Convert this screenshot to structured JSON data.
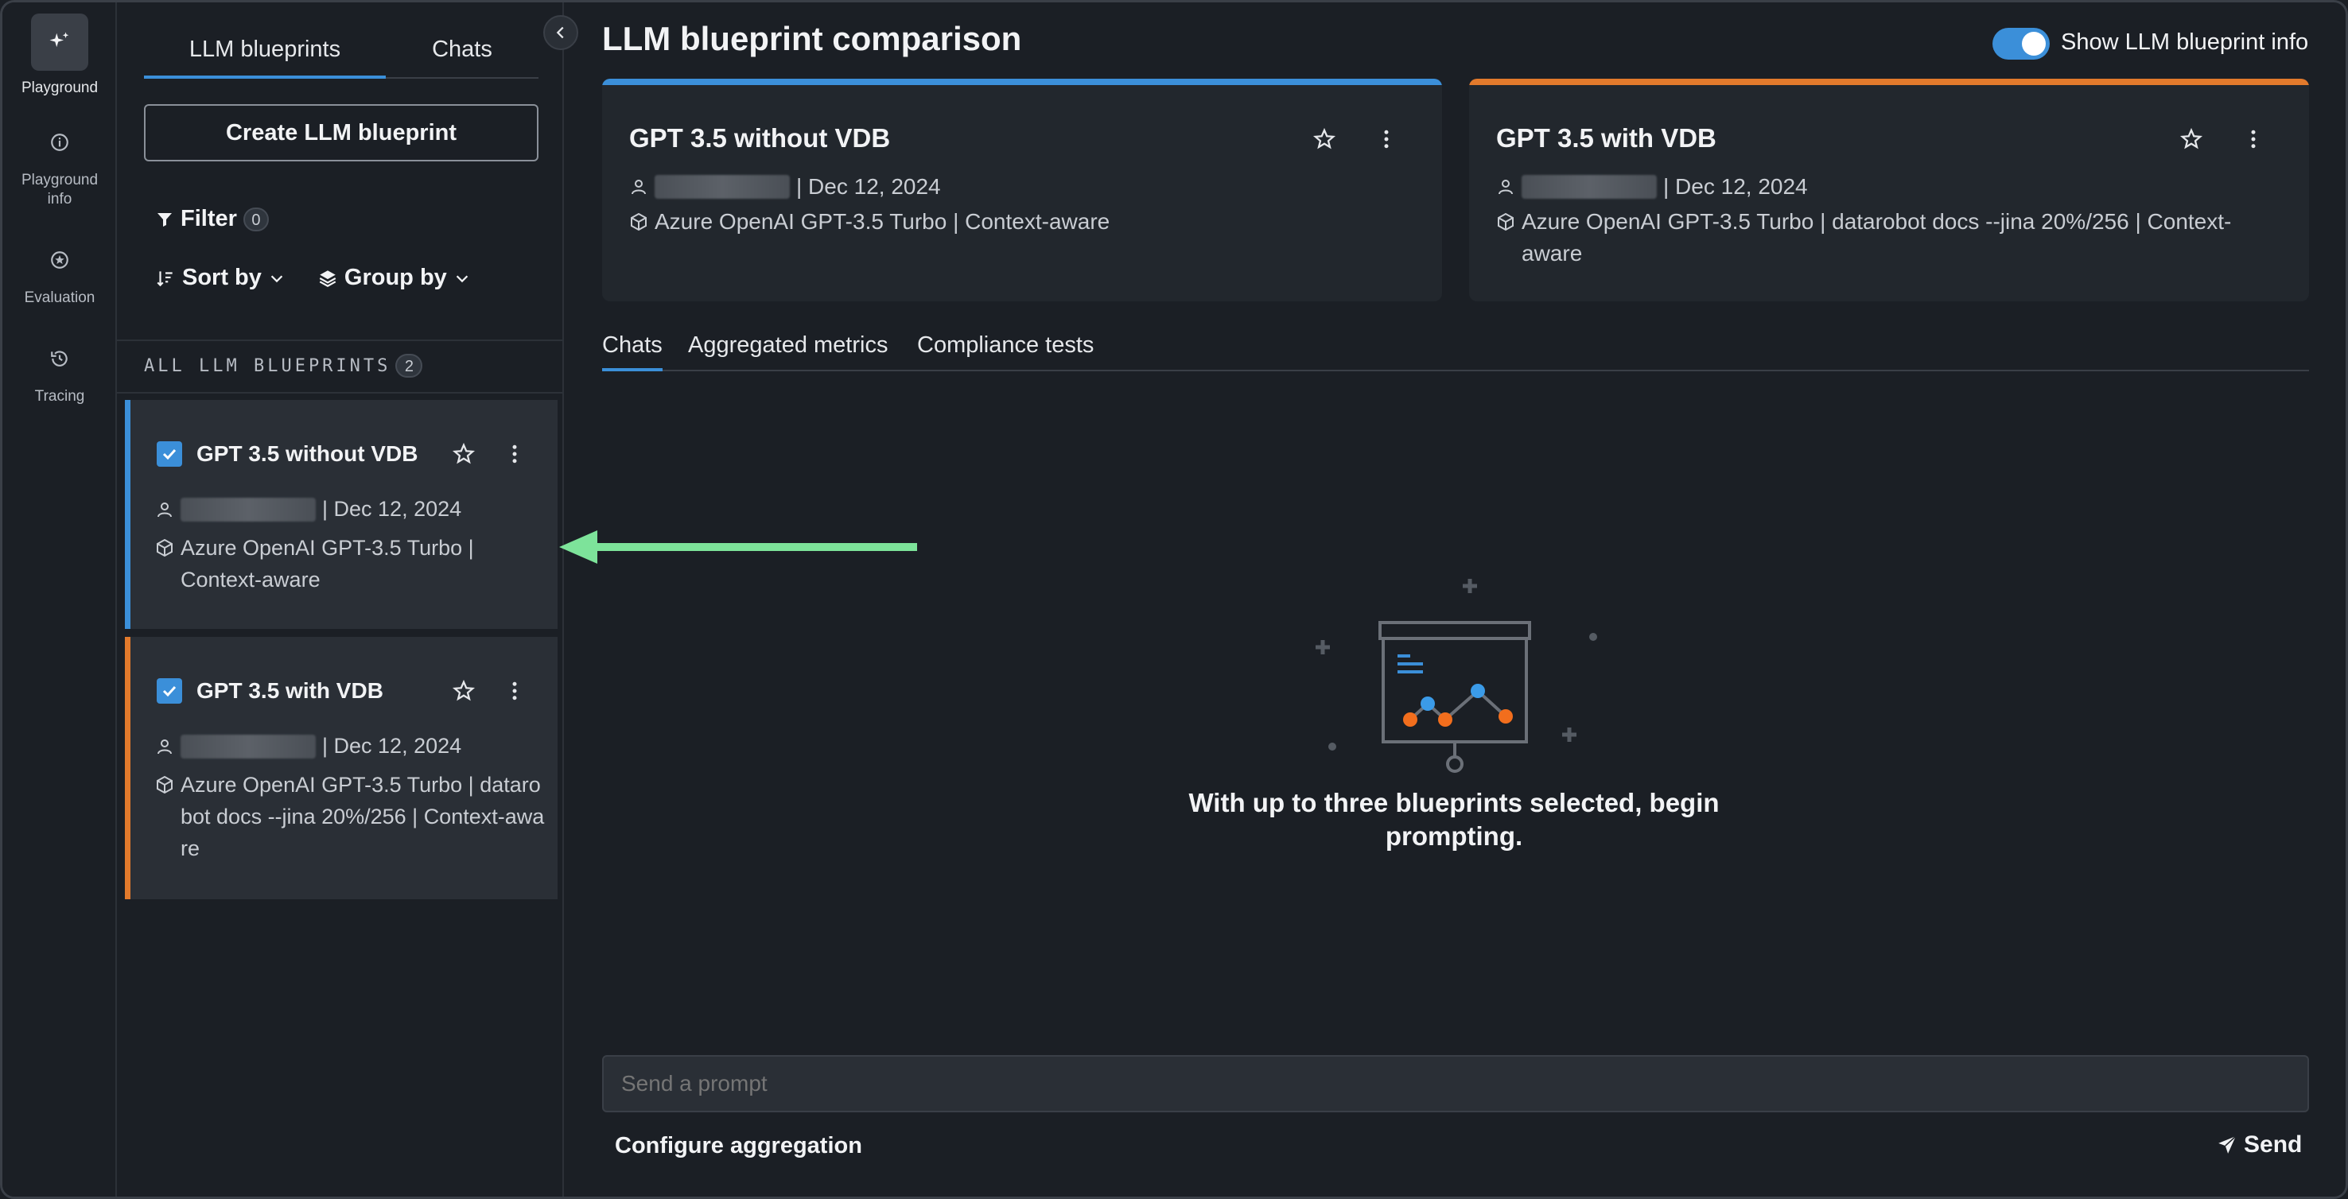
{
  "rail": {
    "items": [
      {
        "label": "Playground",
        "icon": "sparkle-icon",
        "active": true
      },
      {
        "label": "Playground info",
        "icon": "info-icon",
        "active": false
      },
      {
        "label": "Evaluation",
        "icon": "evaluation-icon",
        "active": false
      },
      {
        "label": "Tracing",
        "icon": "history-icon",
        "active": false
      }
    ]
  },
  "panel": {
    "tabs": [
      {
        "label": "LLM blueprints",
        "active": true
      },
      {
        "label": "Chats",
        "active": false
      }
    ],
    "create_label": "Create LLM blueprint",
    "filter_label": "Filter",
    "filter_count": "0",
    "sort_label": "Sort by",
    "group_label": "Group by",
    "section_title": "ALL LLM BLUEPRINTS",
    "section_count": "2",
    "blueprints": [
      {
        "title": "GPT 3.5 without VDB",
        "date": "| Dec 12, 2024",
        "model": "Azure OpenAI GPT-3.5 Turbo | Context-aware",
        "checked": true,
        "accent": "#3b8fd9"
      },
      {
        "title": "GPT 3.5 with VDB",
        "date": "| Dec 12, 2024",
        "model": "Azure OpenAI GPT-3.5 Turbo | datarobot docs --jina 20%/256 | Context-aware",
        "checked": true,
        "accent": "#e27a2c"
      }
    ]
  },
  "main": {
    "title": "LLM blueprint comparison",
    "toggle_label": "Show LLM blueprint info",
    "toggle_on": true,
    "cards": [
      {
        "title": "GPT 3.5 without VDB",
        "date": "| Dec 12, 2024",
        "model": "Azure OpenAI GPT-3.5 Turbo | Context-aware",
        "accent": "#3b8fd9"
      },
      {
        "title": "GPT 3.5 with VDB",
        "date": "| Dec 12, 2024",
        "model": "Azure OpenAI GPT-3.5 Turbo | datarobot docs --jina 20%/256 | Context-aware",
        "accent": "#e27a2c"
      }
    ],
    "tabs": [
      {
        "label": "Chats",
        "active": true
      },
      {
        "label": "Aggregated metrics",
        "active": false
      },
      {
        "label": "Compliance tests",
        "active": false
      }
    ],
    "empty_text": "With up to three blueprints selected, begin prompting.",
    "prompt_placeholder": "Send a prompt",
    "configure_label": "Configure aggregation",
    "send_label": "Send"
  },
  "colors": {
    "accent_blue": "#3b8fd9",
    "accent_orange": "#e27a2c",
    "annotation_arrow": "#7de39a"
  }
}
